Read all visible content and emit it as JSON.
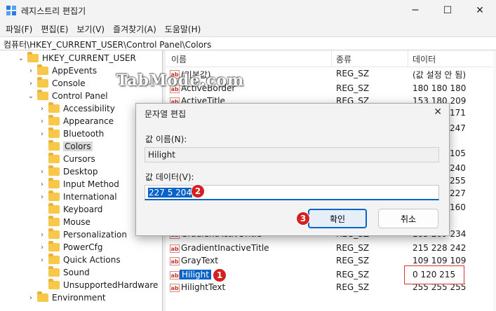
{
  "window": {
    "title": "레지스트리 편집기",
    "minimize_glyph": "─",
    "maximize_glyph": "☐",
    "close_glyph": "✕"
  },
  "menu": [
    "파일(F)",
    "편집(E)",
    "보기(V)",
    "즐겨찾기(A)",
    "도움말(H)"
  ],
  "address": "컴퓨터\\HKEY_CURRENT_USER\\Control Panel\\Colors",
  "tree": [
    {
      "label": "HKEY_CURRENT_USER",
      "level": 0,
      "expanded": true
    },
    {
      "label": "AppEvents",
      "level": 1,
      "expanded": false
    },
    {
      "label": "Console",
      "level": 1,
      "expanded": false
    },
    {
      "label": "Control Panel",
      "level": 1,
      "expanded": true
    },
    {
      "label": "Accessibility",
      "level": 2,
      "expanded": false
    },
    {
      "label": "Appearance",
      "level": 2,
      "expanded": false
    },
    {
      "label": "Bluetooth",
      "level": 2,
      "expanded": false
    },
    {
      "label": "Colors",
      "level": 2,
      "selected": true
    },
    {
      "label": "Cursors",
      "level": 2
    },
    {
      "label": "Desktop",
      "level": 2,
      "expanded": false
    },
    {
      "label": "Input Method",
      "level": 2,
      "expanded": false
    },
    {
      "label": "International",
      "level": 2,
      "expanded": false
    },
    {
      "label": "Keyboard",
      "level": 2
    },
    {
      "label": "Mouse",
      "level": 2
    },
    {
      "label": "Personalization",
      "level": 2,
      "expanded": false
    },
    {
      "label": "PowerCfg",
      "level": 2,
      "expanded": false
    },
    {
      "label": "Quick Actions",
      "level": 2,
      "expanded": false
    },
    {
      "label": "Sound",
      "level": 2
    },
    {
      "label": "UnsupportedHardware",
      "level": 2
    },
    {
      "label": "Environment",
      "level": 1,
      "expanded": false
    }
  ],
  "columns": {
    "name": "이름",
    "type": "종류",
    "data": "데이터"
  },
  "values_top": [
    {
      "name": "(기본값)",
      "type": "REG_SZ",
      "data": "(값 설정 안 됨)"
    },
    {
      "name": "ActiveBorder",
      "type": "REG_SZ",
      "data": "180 180 180"
    },
    {
      "name": "ActiveTitle",
      "type": "REG_SZ",
      "data": "153 180 209"
    }
  ],
  "values_partial_data": [
    "171",
    "247",
    "105",
    "240",
    "255",
    "227",
    "160"
  ],
  "values_bottom": [
    {
      "name": "GradientActiveTitle",
      "type": "REG_SZ",
      "data": "185 209 234"
    },
    {
      "name": "GradientInactiveTitle",
      "type": "REG_SZ",
      "data": "215 228 242"
    },
    {
      "name": "GrayText",
      "type": "REG_SZ",
      "data": "109 109 109"
    },
    {
      "name": "Hilight",
      "type": "REG_SZ",
      "data": "0 120 215",
      "selected": true
    },
    {
      "name": "HilightText",
      "type": "REG_SZ",
      "data": "255 255 255"
    }
  ],
  "value_icon_text": "ab",
  "watermark": "TabMode.com",
  "dialog": {
    "title": "문자열 편집",
    "name_label": "값 이름(N):",
    "name_value": "Hilight",
    "data_label": "값 데이터(V):",
    "data_value": "227 5 204",
    "ok_label": "확인",
    "cancel_label": "취소"
  },
  "badges": [
    "1",
    "2",
    "3"
  ],
  "colors": {
    "accent": "#0a64c8",
    "badge": "#d61f1f",
    "folder": "#f7c84a"
  }
}
